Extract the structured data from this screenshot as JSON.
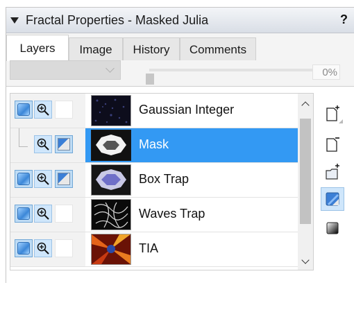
{
  "panel": {
    "title": "Fractal Properties - Masked Julia",
    "help_label": "?"
  },
  "tabs": [
    {
      "label": "Layers",
      "active": true
    },
    {
      "label": "Image",
      "active": false
    },
    {
      "label": "History",
      "active": false
    },
    {
      "label": "Comments",
      "active": false
    }
  ],
  "toolbar": {
    "blend_mode_value": "",
    "opacity_percent": 0,
    "opacity_label": "0%"
  },
  "layers": [
    {
      "name": "Gaussian Integer",
      "selected": false,
      "is_mask": false,
      "visible": true,
      "mask_enabled": false
    },
    {
      "name": "Mask",
      "selected": true,
      "is_mask": true,
      "visible": false,
      "mask_enabled": true
    },
    {
      "name": "Box Trap",
      "selected": false,
      "is_mask": false,
      "visible": true,
      "mask_enabled": true
    },
    {
      "name": "Waves Trap",
      "selected": false,
      "is_mask": false,
      "visible": true,
      "mask_enabled": false
    },
    {
      "name": "TIA",
      "selected": false,
      "is_mask": false,
      "visible": true,
      "mask_enabled": false
    }
  ],
  "side_toolbar": [
    {
      "icon": "add-layer-icon",
      "active": false
    },
    {
      "icon": "remove-layer-icon",
      "active": false
    },
    {
      "icon": "add-group-icon",
      "active": false
    },
    {
      "icon": "add-mask-icon",
      "active": true
    },
    {
      "icon": "gradient-layer-icon",
      "active": false
    }
  ],
  "colors": {
    "selection": "#3399f3",
    "title_bar": "#dfe3e9",
    "active_toggle": "#bfdcf5"
  }
}
